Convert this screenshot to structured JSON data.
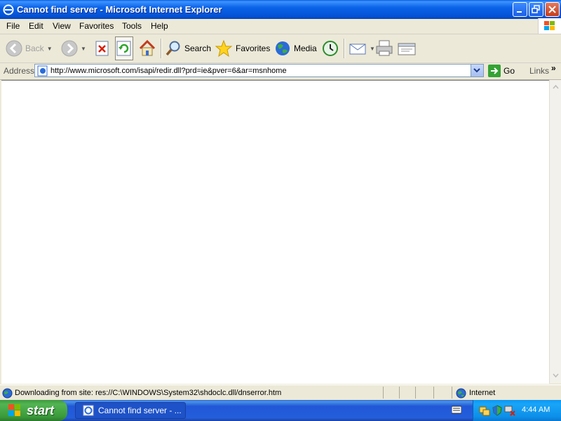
{
  "window": {
    "title": "Cannot find server - Microsoft Internet Explorer"
  },
  "menu": [
    "File",
    "Edit",
    "View",
    "Favorites",
    "Tools",
    "Help"
  ],
  "toolbar": {
    "back_label": "Back",
    "search_label": "Search",
    "favorites_label": "Favorites",
    "media_label": "Media"
  },
  "address": {
    "label": "Address",
    "url": "http://www.microsoft.com/isapi/redir.dll?prd=ie&pver=6&ar=msnhome",
    "go_label": "Go",
    "links_label": "Links",
    "links_chevron": "»"
  },
  "status": {
    "text": "Downloading from site: res://C:\\WINDOWS\\System32\\shdoclc.dll/dnserror.htm",
    "zone": "Internet"
  },
  "taskbar": {
    "start_label": "start",
    "task_label": "Cannot find server - ...",
    "clock": "4:44 AM"
  },
  "colors": {
    "titlebar": "#0a63e8",
    "chrome": "#ece9d8",
    "taskbar": "#245edb",
    "start": "#3a9a3a"
  }
}
